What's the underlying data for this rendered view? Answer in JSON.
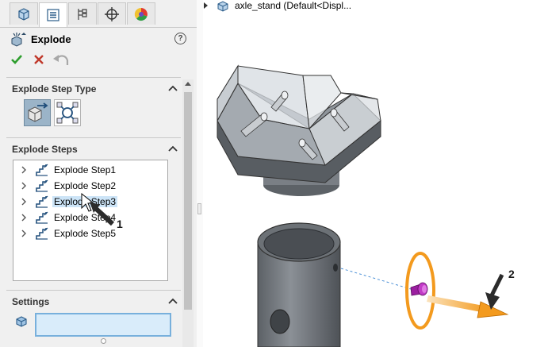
{
  "tabs": [
    {
      "id": "feature-manager",
      "icon": "feature-manager-icon"
    },
    {
      "id": "property-manager",
      "icon": "property-manager-icon",
      "active": true
    },
    {
      "id": "configuration-manager",
      "icon": "configuration-manager-icon"
    },
    {
      "id": "dimxpert-manager",
      "icon": "dimxpert-icon"
    },
    {
      "id": "display-manager",
      "icon": "display-manager-icon"
    }
  ],
  "property_manager": {
    "title": "Explode",
    "help_label": "?",
    "actions": [
      {
        "id": "ok",
        "icon": "checkmark-icon",
        "color": "#2e9e2e"
      },
      {
        "id": "cancel",
        "icon": "close-icon",
        "color": "#c0392b"
      },
      {
        "id": "undo",
        "icon": "undo-icon",
        "color": "#9a9a9a"
      }
    ]
  },
  "groups": {
    "step_type": {
      "title": "Explode Step Type",
      "options": [
        {
          "id": "regular",
          "icon": "regular-explode-step-icon",
          "selected": true
        },
        {
          "id": "radial",
          "icon": "radial-explode-step-icon",
          "selected": false
        }
      ]
    },
    "steps": {
      "title": "Explode Steps",
      "items": [
        {
          "label": "Explode Step1",
          "selected": false
        },
        {
          "label": "Explode Step2",
          "selected": false
        },
        {
          "label": "Explode Step3",
          "selected": true
        },
        {
          "label": "Explode Step4",
          "selected": false
        },
        {
          "label": "Explode Step5",
          "selected": false
        }
      ]
    },
    "settings": {
      "title": "Settings",
      "field_value": ""
    }
  },
  "graphics": {
    "tree_label": "axle_stand  (Default<Displ...",
    "callouts": [
      "1",
      "2"
    ]
  },
  "colors": {
    "selection": "#cce4f7",
    "manipulator": "#f39a1e",
    "screw": "#b21fb3",
    "part_grey": "#6e7378"
  }
}
